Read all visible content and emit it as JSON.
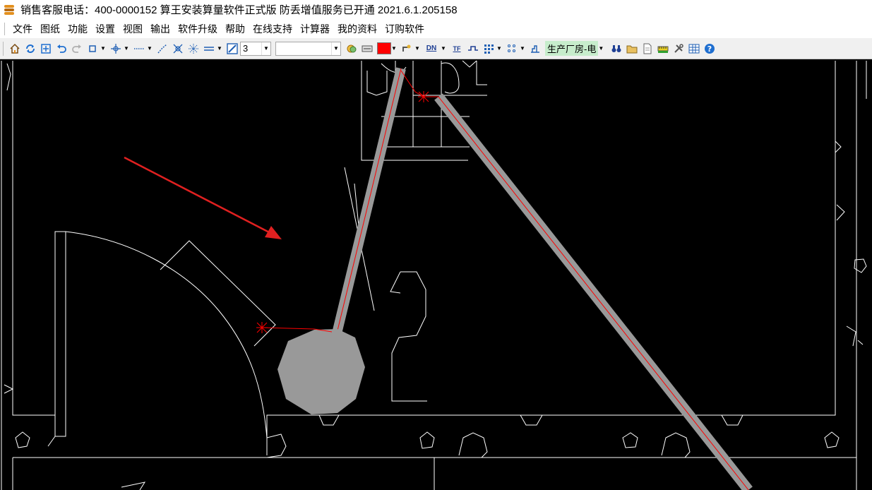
{
  "window": {
    "title": "销售客服电话：400-0000152   算王安装算量软件正式版  防丢增值服务已开通 2021.6.1.205158"
  },
  "menu": {
    "items": [
      "文件",
      "图纸",
      "功能",
      "设置",
      "视图",
      "输出",
      "软件升级",
      "帮助",
      "在线支持",
      "计算器",
      "我的资料",
      "订购软件"
    ]
  },
  "toolbar": {
    "line_width_value": "3",
    "linetype_value": "",
    "color": "#ff0000",
    "layer_label": "生产厂房-电",
    "dn_label": "DN",
    "tf_label": "TF"
  },
  "canvas": {
    "background": "#000000",
    "line_color": "#ffffff",
    "pipe_color": "#999999",
    "highlight_color": "#ff0000",
    "arrow_color": "#e02020"
  }
}
